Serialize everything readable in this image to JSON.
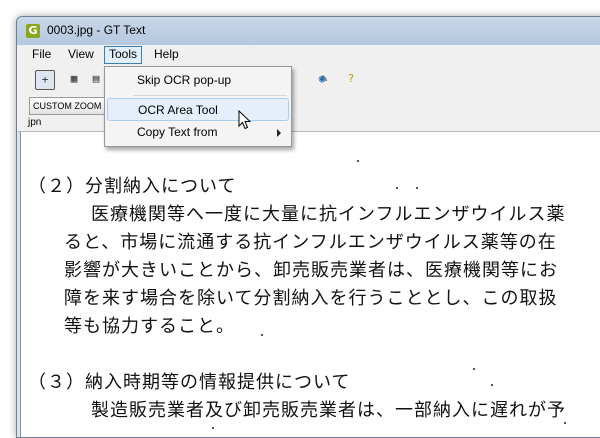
{
  "window": {
    "title": "0003.jpg - GT Text",
    "app_icon_letter": "G"
  },
  "menubar": {
    "items": [
      "File",
      "View",
      "Tools",
      "Help"
    ],
    "open": "Tools"
  },
  "toolbar": {
    "zoom_label": "CUSTOM ZOOM"
  },
  "language": {
    "label": "jpn"
  },
  "dropdown": {
    "items": [
      {
        "label": "Skip OCR pop-up"
      },
      {
        "label": "OCR Area Tool"
      },
      {
        "label": "Copy Text from",
        "submenu": true
      }
    ]
  },
  "document": {
    "lines": [
      "（２）分割納入について",
      "医療機関等へ一度に大量に抗インフルエンザウイルス薬",
      "ると、市場に流通する抗インフルエンザウイルス薬等の在",
      "影響が大きいことから、卸売販売業者は、医療機関等にお",
      "障を来す場合を除いて分割納入を行うこととし、この取扱",
      "等も協力すること。",
      "（３）納入時期等の情報提供について",
      "製造販売業者及び卸売販売業者は、一部納入に遅れが予"
    ]
  }
}
